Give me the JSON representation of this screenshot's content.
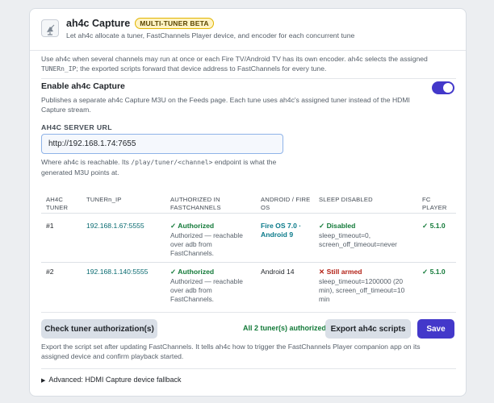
{
  "header": {
    "title": "ah4c Capture",
    "badge": "MULTI-TUNER BETA",
    "subtitle": "Let ah4c allocate a tuner, FastChannels Player device, and encoder for each concurrent tune"
  },
  "intro": {
    "part1": "Use ah4c when several channels may run at once or each Fire TV/Android TV has its own encoder. ah4c selects the assigned ",
    "code": "TUNERn_IP",
    "part2": "; the exported scripts forward that device address to FastChannels for every tune."
  },
  "enable": {
    "label": "Enable ah4c Capture",
    "description": "Publishes a separate ah4c Capture M3U on the Feeds page. Each tune uses ah4c's assigned tuner instead of the HDMI Capture stream.",
    "enabled": true
  },
  "server": {
    "label": "AH4C SERVER URL",
    "value": "http://192.168.1.74:7655",
    "help_part1": "Where ah4c is reachable. Its ",
    "help_code": "/play/tuner/<channel>",
    "help_part2": " endpoint is what the generated M3U points at."
  },
  "table": {
    "headers": {
      "tuner_line1": "AH4C",
      "tuner_line2": "TUNER",
      "ip": "TUNERn_IP",
      "auth_line1": "AUTHORIZED IN",
      "auth_line2": "FASTCHANNELS",
      "os_line1": "ANDROID / FIRE",
      "os_line2": "OS",
      "sleep": "SLEEP DISABLED",
      "fc_line1": "FC",
      "fc_line2": "PLAYER"
    },
    "rows": [
      {
        "tuner": "#1",
        "ip": "192.168.1.67:5555",
        "auth_status": "✓ Authorized",
        "auth_detail": "Authorized — reachable over adb from FastChannels.",
        "os": "Fire OS 7.0 · Android 9",
        "sleep_status": "✓ Disabled",
        "sleep_detail": "sleep_timeout=0, screen_off_timeout=never",
        "fc_player": "✓ 5.1.0"
      },
      {
        "tuner": "#2",
        "ip": "192.168.1.140:5555",
        "auth_status": "✓ Authorized",
        "auth_detail": "Authorized — reachable over adb from FastChannels.",
        "os": "Android 14",
        "sleep_status": "✕ Still armed",
        "sleep_detail": "sleep_timeout=1200000 (20 min), screen_off_timeout=10 min",
        "fc_player": "✓ 5.1.0"
      }
    ]
  },
  "actions": {
    "check_label": "Check tuner authorization(s)",
    "auth_status": "All 2 tuner(s) authorized",
    "export_label": "Export ah4c scripts",
    "save_label": "Save"
  },
  "export_help": "Export the script set after updating FastChannels. It tells ah4c how to trigger the FastChannels Player companion app on its assigned device and confirm playback started.",
  "advanced": {
    "label": "Advanced: HDMI Capture device fallback"
  },
  "colors": {
    "accent": "#4338ca",
    "success": "#137a39",
    "danger": "#b42318",
    "link": "#0a6b71"
  }
}
